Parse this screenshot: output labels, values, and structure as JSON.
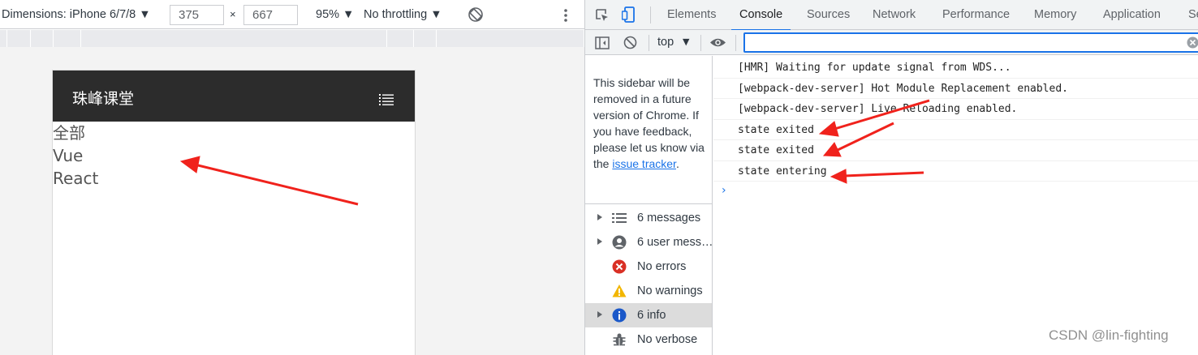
{
  "device_toolbar": {
    "dimensions_label": "Dimensions: iPhone 6/7/8 ▼",
    "width": "375",
    "times": "×",
    "height": "667",
    "zoom": "95% ▼",
    "throttling": "No throttling ▼"
  },
  "page": {
    "app_title": "珠峰课堂",
    "nav_links": [
      "全部",
      "Vue",
      "React"
    ]
  },
  "devtools": {
    "tabs": [
      "Elements",
      "Console",
      "Sources",
      "Network",
      "Performance",
      "Memory",
      "Application",
      "Se"
    ],
    "active_tab": "Console",
    "context": "top",
    "filter_value": "",
    "sidebar": {
      "note_text": "This sidebar will be removed in a future version of Chrome. If you have feedback, please let us know via the",
      "link_text": "issue tracker",
      "note_end": ".",
      "items": [
        {
          "label": "6 messages",
          "icon": "list-icon"
        },
        {
          "label": "6 user mess…",
          "icon": "user-icon"
        },
        {
          "label": "No errors",
          "icon": "error-icon"
        },
        {
          "label": "No warnings",
          "icon": "warning-icon"
        },
        {
          "label": "6 info",
          "icon": "info-icon"
        },
        {
          "label": "No verbose",
          "icon": "bug-icon"
        }
      ]
    },
    "log": [
      "[HMR] Waiting for update signal from WDS...",
      "[webpack-dev-server] Hot Module Replacement enabled.",
      "[webpack-dev-server] Live Reloading enabled.",
      "state exited",
      "state exited",
      "state entering"
    ],
    "prompt": "›"
  },
  "colors": {
    "accent": "#1a73e8",
    "header_bg": "#2c2c2c",
    "annotation_arrow": "#f0221c",
    "error": "#d93025",
    "warning": "#f2b600",
    "info": "#1a58c9"
  },
  "watermark": "CSDN @lin-fighting"
}
